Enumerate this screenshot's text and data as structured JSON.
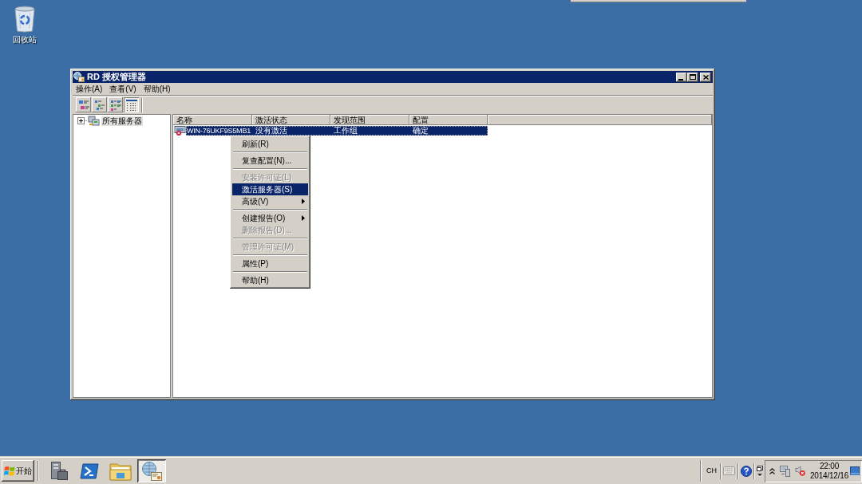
{
  "desktop": {
    "icons": [
      {
        "label": "回收站"
      }
    ]
  },
  "window": {
    "title": "RD 授权管理器",
    "menu": [
      "操作(A)",
      "查看(V)",
      "帮助(H)"
    ],
    "toolbar": [
      {
        "selected": false
      },
      {
        "selected": false
      },
      {
        "selected": false
      },
      {
        "selected": true
      }
    ],
    "tree": [
      {
        "label": "所有服务器",
        "expanded": false,
        "selected": true
      }
    ],
    "table": {
      "columns": [
        "名称",
        "激活状态",
        "发现范围",
        "配置"
      ],
      "rows": [
        {
          "cells": [
            "WIN-76UKF9S5MB1",
            "没有激活",
            "工作组",
            "确定"
          ],
          "selected": true
        }
      ]
    }
  },
  "context_menu": {
    "items": [
      {
        "kind": "item",
        "label": "刷新(R)",
        "disabled": false,
        "selected": false,
        "submenu": false
      },
      {
        "kind": "separator"
      },
      {
        "kind": "item",
        "label": "复查配置(N)...",
        "disabled": false,
        "selected": false,
        "submenu": false
      },
      {
        "kind": "separator"
      },
      {
        "kind": "item",
        "label": "安装许可证(L)",
        "disabled": true,
        "selected": false,
        "submenu": false
      },
      {
        "kind": "item",
        "label": "激活服务器(S)",
        "disabled": false,
        "selected": true,
        "submenu": false
      },
      {
        "kind": "item",
        "label": "高级(V)",
        "disabled": false,
        "selected": false,
        "submenu": true
      },
      {
        "kind": "separator"
      },
      {
        "kind": "item",
        "label": "创建报告(O)",
        "disabled": false,
        "selected": false,
        "submenu": true
      },
      {
        "kind": "item",
        "label": "删除报告(D)...",
        "disabled": true,
        "selected": false,
        "submenu": false
      },
      {
        "kind": "separator"
      },
      {
        "kind": "item",
        "label": "管理许可证(M)",
        "disabled": true,
        "selected": false,
        "submenu": false
      },
      {
        "kind": "separator"
      },
      {
        "kind": "item",
        "label": "属性(P)",
        "disabled": false,
        "selected": false,
        "submenu": false
      },
      {
        "kind": "separator"
      },
      {
        "kind": "item",
        "label": "帮助(H)",
        "disabled": false,
        "selected": false,
        "submenu": false
      }
    ]
  },
  "taskbar": {
    "start": "开始",
    "apps": [
      {
        "selected": false
      },
      {
        "selected": false
      },
      {
        "selected": false
      },
      {
        "selected": true
      }
    ],
    "language": "CH",
    "clock": {
      "time": "22:00",
      "date": "2014/12/16"
    }
  }
}
